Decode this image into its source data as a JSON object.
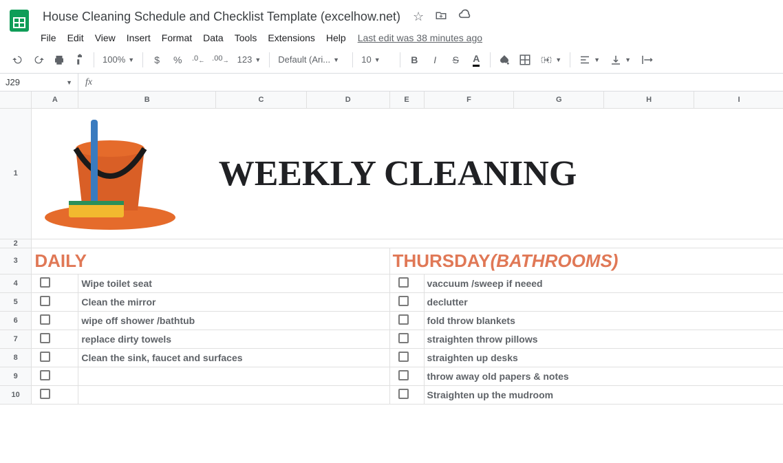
{
  "doc": {
    "title": "House Cleaning Schedule and Checklist Template (excelhow.net)",
    "last_edit": "Last edit was 38 minutes ago"
  },
  "menu": {
    "file": "File",
    "edit": "Edit",
    "view": "View",
    "insert": "Insert",
    "format": "Format",
    "data": "Data",
    "tools": "Tools",
    "extensions": "Extensions",
    "help": "Help"
  },
  "toolbar": {
    "zoom": "100%",
    "currency": "$",
    "percent": "%",
    "dec_dec": ".0",
    "inc_dec": ".00",
    "num_fmt": "123",
    "font": "Default (Ari...",
    "size": "10",
    "bold": "B",
    "italic": "I",
    "strike": "S",
    "textcolor": "A"
  },
  "formula": {
    "cell_ref": "J29",
    "value": ""
  },
  "columns": [
    "A",
    "B",
    "C",
    "D",
    "E",
    "F",
    "G",
    "H",
    "I"
  ],
  "col_widths": {
    "A": 68,
    "B": 200,
    "C": 132,
    "D": 121,
    "E": 50,
    "F": 131,
    "G": 131,
    "H": 131,
    "I": 131
  },
  "rows": [
    "1",
    "2",
    "3",
    "4",
    "5",
    "6",
    "7",
    "8",
    "9",
    "10"
  ],
  "content": {
    "big_title": "WEEKLY CLEANING",
    "daily_header": "DAILY",
    "thursday_header": "THURSDAY",
    "thursday_sub": "(BATHROOMS)",
    "daily_tasks": [
      "Wipe toilet seat",
      "Clean the mirror",
      "wipe off shower /bathtub",
      "replace dirty towels",
      "Clean the sink, faucet and surfaces"
    ],
    "thursday_tasks": [
      "vaccuum /sweep if neeed",
      "declutter",
      "fold throw blankets",
      "straighten throw pillows",
      "straighten up desks",
      "throw away old papers & notes",
      "Straighten up the mudroom"
    ]
  }
}
